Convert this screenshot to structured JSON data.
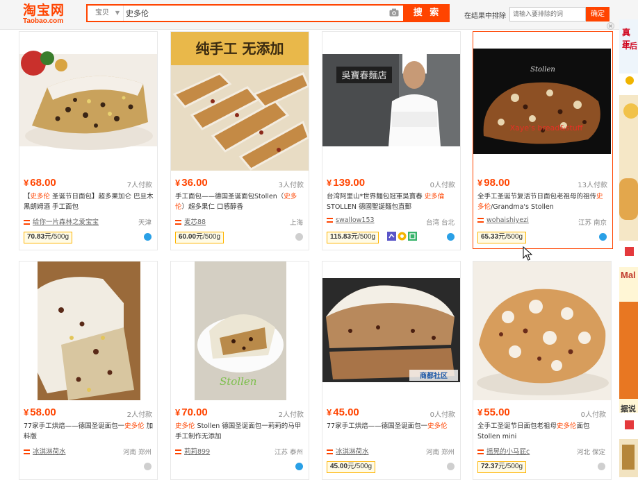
{
  "header": {
    "logo_cn": "淘宝网",
    "logo_en": "Taobao.com",
    "search_category": "宝贝",
    "search_query": "史多伦",
    "search_button": "搜 索",
    "exclude_label": "在结果中排除",
    "exclude_placeholder": "请输入要排除的词",
    "exclude_button": "确定"
  },
  "products": [
    {
      "price": "68.00",
      "paid": "7人付款",
      "title_parts": [
        "【",
        "史多伦",
        " 圣诞节日面包】超多果加仑 巴旦木 黑朗姆酒 手工面包"
      ],
      "shop": "给你一片森林之爱宝宝",
      "location": "天津",
      "unit_value": "70.83",
      "unit_suffix": "元/500g"
    },
    {
      "price": "36.00",
      "paid": "3人付款",
      "title_parts": [
        "手工面包——德国圣诞面包Stollen（",
        "史多伦",
        "）超多果仁 口感醇香"
      ],
      "shop": "麦芯88",
      "location": "上海",
      "unit_value": "60.00",
      "unit_suffix": "元/500g"
    },
    {
      "price": "139.00",
      "paid": "0人付款",
      "title_parts": [
        "台湾阿里山*世界麵包冠軍吳寶春 ",
        "史多倫",
        " STOLLEN 德國聖誕麵包直郵"
      ],
      "shop": "swallow153",
      "location": "台湾 台北",
      "unit_value": "115.83",
      "unit_suffix": "元/500g"
    },
    {
      "price": "98.00",
      "paid": "13人付款",
      "title_parts": [
        "全手工圣诞节复活节日面包老祖母的祖传",
        "史多伦",
        "/Grandma's Stollen"
      ],
      "shop": "wohaishiyezi",
      "location": "江苏 南京",
      "unit_value": "65.33",
      "unit_suffix": "元/500g",
      "img_text": "Stollen",
      "img_watermark": "Xaye's bread&stuff"
    },
    {
      "price": "58.00",
      "paid": "2人付款",
      "title_parts": [
        "77家手工烘焙——德国圣诞面包一",
        "史多伦",
        " 加料版"
      ],
      "shop": "冰淇淋荷水",
      "location": "河南 郑州",
      "unit_value": "",
      "unit_suffix": ""
    },
    {
      "price": "70.00",
      "paid": "2人付款",
      "title_parts": [
        "",
        "史多伦",
        " Stollen 德国圣诞面包一莉莉的马甲手工制作无添加"
      ],
      "shop": "莉莉899",
      "location": "江苏 泰州",
      "unit_value": "",
      "unit_suffix": "",
      "img_text": "Stollen"
    },
    {
      "price": "45.00",
      "paid": "0人付款",
      "title_parts": [
        "77家手工烘焙——德国圣诞面包一",
        "史多伦",
        ""
      ],
      "shop": "冰淇淋荷水",
      "location": "河南 郑州",
      "unit_value": "45.00",
      "unit_suffix": "元/500g",
      "img_text": "商都社区"
    },
    {
      "price": "55.00",
      "paid": "0人付款",
      "title_parts": [
        "全手工圣诞节日面包老祖母",
        "史多伦",
        "面包 Stollen mini"
      ],
      "shop": "摇晃的小马屁c",
      "location": "河北 保定",
      "unit_value": "72.37",
      "unit_suffix": "元/500g"
    }
  ],
  "card2_banner": "纯手工 无添加",
  "card3_sign": "吳寶春麵店",
  "ads": {
    "a1": "真正",
    "a2": "年后",
    "a3": "Mal",
    "a4": "据说"
  },
  "colors": {
    "accent": "#ff4400",
    "link_blue": "#2aa0e6"
  }
}
